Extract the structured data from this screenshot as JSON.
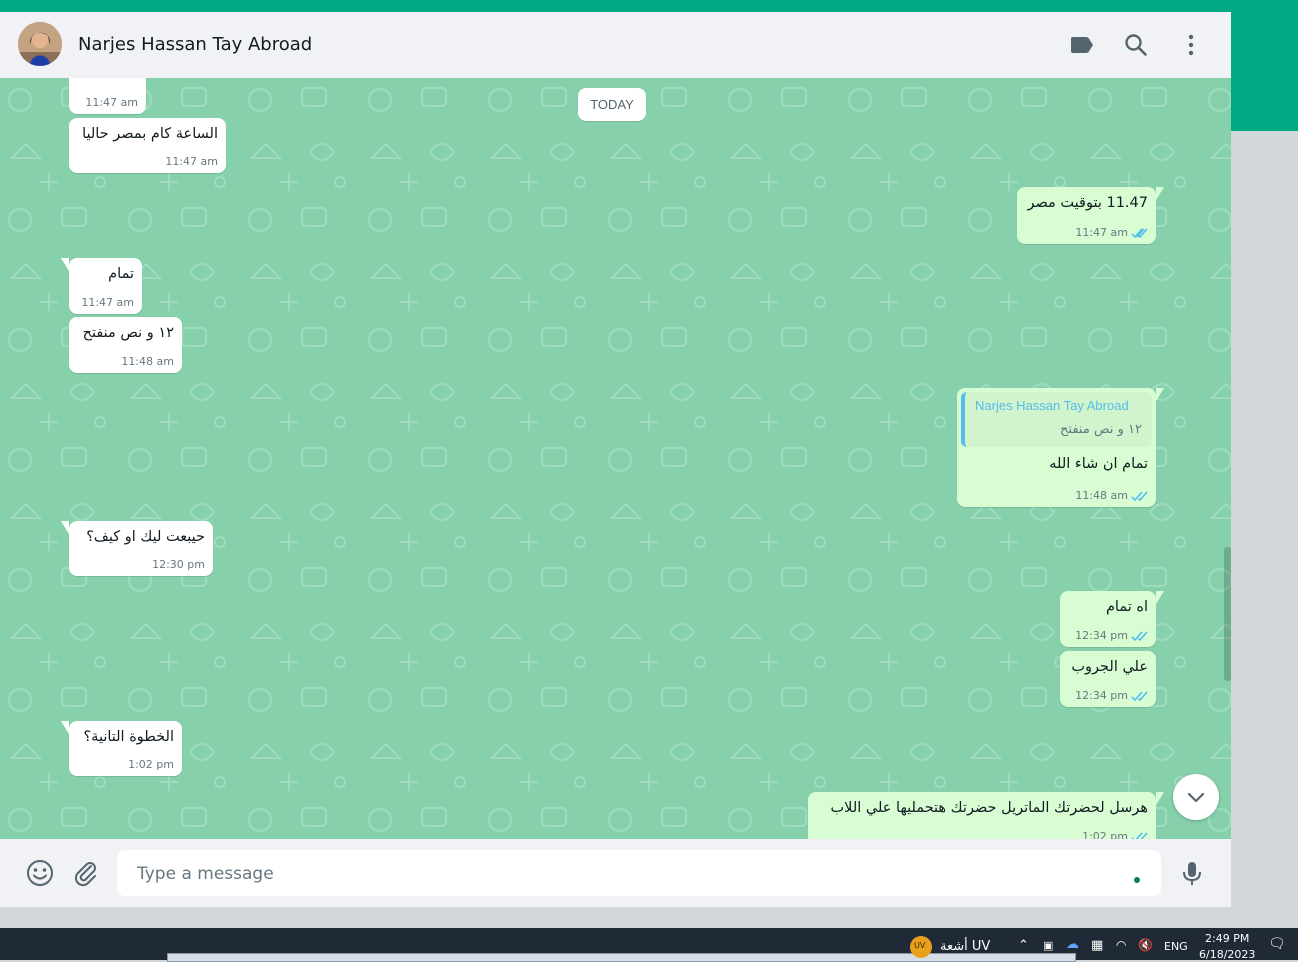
{
  "header": {
    "contact_name": "Narjes Hassan Tay Abroad"
  },
  "chat": {
    "date_chip": "TODAY",
    "messages": [
      {
        "dir": "in",
        "text": "",
        "time": "11:47 am"
      },
      {
        "dir": "in",
        "text": "الساعة كام بمصر حاليا",
        "time": "11:47 am"
      },
      {
        "dir": "out",
        "text": "11.47 بتوقيت مصر",
        "time": "11:47 am"
      },
      {
        "dir": "in",
        "text": "تمام",
        "time": "11:47 am"
      },
      {
        "dir": "in",
        "text": "١٢ و نص منفتح",
        "time": "11:48 am"
      },
      {
        "dir": "out",
        "text": "تمام ان شاء الله",
        "time": "11:48 am",
        "quote_author": "Narjes Hassan Tay Abroad",
        "quote_text": "١٢ و نص منفتح"
      },
      {
        "dir": "in",
        "text": "حيبعت ليك او كيف؟",
        "time": "12:30 pm"
      },
      {
        "dir": "out",
        "text": "اه تمام",
        "time": "12:34 pm"
      },
      {
        "dir": "out",
        "text": "علي الجروب",
        "time": "12:34 pm"
      },
      {
        "dir": "in",
        "text": "الخطوة التانية؟",
        "time": "1:02 pm"
      },
      {
        "dir": "out",
        "text": "هرسل لحضرتك الماتريل حضرتك هتحمليها علي اللاب",
        "time": "1:02 pm"
      }
    ]
  },
  "composer": {
    "placeholder": "Type a message"
  },
  "taskbar": {
    "uv_badge": "UV",
    "uv_label": "أشعة UV",
    "lang": "ENG",
    "time": "2:49 PM",
    "date": "6/18/2023"
  },
  "colors": {
    "accent": "#00a884",
    "chat_bg": "#86d1ac",
    "incoming_bubble": "#ffffff",
    "outgoing_bubble": "#d9fdd3",
    "read_ticks": "#53bdeb"
  },
  "icons": [
    "label-icon",
    "search-icon",
    "menu-icon",
    "emoji-icon",
    "attach-icon",
    "mic-icon",
    "chevron-down-icon"
  ]
}
